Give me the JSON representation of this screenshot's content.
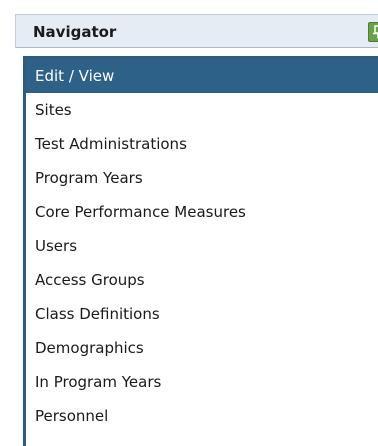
{
  "navigator": {
    "title": "Navigator",
    "pin_icon": "pin-icon",
    "pin_color": "#6aa04a",
    "selected_color": "#2e6188",
    "items": [
      {
        "label": "Edit / View",
        "selected": true
      },
      {
        "label": "Sites",
        "selected": false
      },
      {
        "label": "Test Administrations",
        "selected": false
      },
      {
        "label": "Program Years",
        "selected": false
      },
      {
        "label": "Core Performance Measures",
        "selected": false
      },
      {
        "label": "Users",
        "selected": false
      },
      {
        "label": "Access Groups",
        "selected": false
      },
      {
        "label": "Class Definitions",
        "selected": false
      },
      {
        "label": "Demographics",
        "selected": false
      },
      {
        "label": "In Program Years",
        "selected": false
      },
      {
        "label": "Personnel",
        "selected": false
      }
    ]
  }
}
